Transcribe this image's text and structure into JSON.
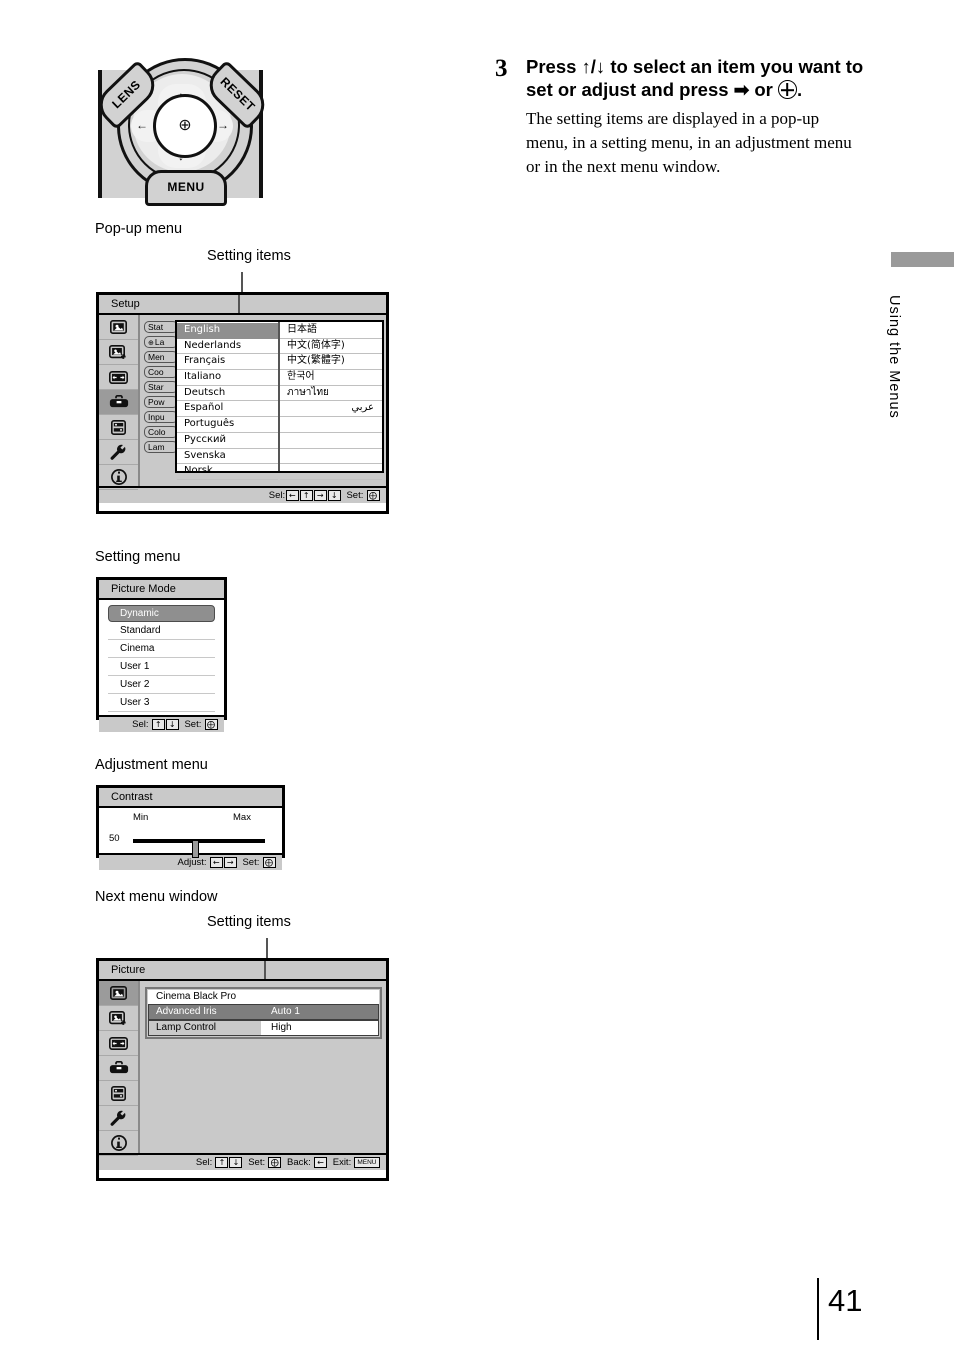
{
  "instruction": {
    "step_number": "3",
    "heading_part1": "Press",
    "heading_arrows": "↑/↓",
    "heading_part2": "to select an item you want to set or adjust and press",
    "heading_arrow_right": "➡",
    "heading_or": "or",
    "heading_period": ".",
    "description": "The setting items are displayed in a pop-up menu, in a setting menu, in an adjustment menu or in the next menu window."
  },
  "remote": {
    "lens_label": "LENS",
    "reset_label": "RESET",
    "menu_label": "MENU",
    "up_arrow": "↑",
    "down_arrow": "↓",
    "left_arrow": "←",
    "right_arrow": "→",
    "center_glyph": "⊕"
  },
  "captions": {
    "popup_menu": "Pop-up menu",
    "setting_items_1": "Setting items",
    "setting_menu": "Setting menu",
    "adjustment_menu": "Adjustment menu",
    "next_menu_window": "Next menu window",
    "setting_items_2": "Setting items"
  },
  "popup_menu": {
    "title": "Setup",
    "rail_icons": [
      "picture-icon",
      "picture-plus-icon",
      "screen-icon",
      "toolbox-icon",
      "function-list-icon",
      "wrench-icon",
      "info-icon"
    ],
    "rail_selected_index": 3,
    "hidden_items": [
      {
        "label": "Stat",
        "icon": ""
      },
      {
        "label": "La",
        "icon": "⊕"
      },
      {
        "label": "Men",
        "icon": ""
      },
      {
        "label": "Coo",
        "icon": ""
      },
      {
        "label": "Star",
        "icon": ""
      },
      {
        "label": "Pow",
        "icon": ""
      },
      {
        "label": "Inpu",
        "icon": ""
      },
      {
        "label": "Colo",
        "icon": ""
      },
      {
        "label": "Lam",
        "icon": ""
      }
    ],
    "languages_left": [
      "English",
      "Nederlands",
      "Français",
      "Italiano",
      "Deutsch",
      "Español",
      "Português",
      "Русский",
      "Svenska",
      "Norsk"
    ],
    "languages_right": [
      "日本語",
      "中文(简体字)",
      "中文(繁體字)",
      "한국어",
      "ภาษาไทย",
      "عربي"
    ],
    "selected_language": "English",
    "status": {
      "sel_label": "Sel:",
      "sel_keys": [
        "←",
        "↑",
        "→",
        "↓"
      ],
      "set_label": "Set:",
      "set_key": "⨁"
    }
  },
  "setting_menu": {
    "title": "Picture Mode",
    "items": [
      "Dynamic",
      "Standard",
      "Cinema",
      "User 1",
      "User 2",
      "User 3"
    ],
    "selected": "Dynamic",
    "status": {
      "sel_label": "Sel:",
      "sel_keys": [
        "↑",
        "↓"
      ],
      "set_label": "Set:",
      "set_key": "⨁"
    }
  },
  "adjustment_menu": {
    "title": "Contrast",
    "min_label": "Min",
    "max_label": "Max",
    "value": "50",
    "slider_percent": 47,
    "status": {
      "adjust_label": "Adjust:",
      "adjust_keys": [
        "←",
        "→"
      ],
      "set_label": "Set:",
      "set_key": "⨁"
    }
  },
  "next_menu": {
    "title": "Picture",
    "rail_icons": [
      "picture-icon",
      "picture-plus-icon",
      "screen-icon",
      "toolbox-icon",
      "function-list-icon",
      "wrench-icon",
      "info-icon"
    ],
    "rail_selected_index": 0,
    "rows": [
      {
        "label": "Cinema Black Pro",
        "value": "",
        "style": "plain"
      },
      {
        "label": "Advanced Iris",
        "value": "Auto 1",
        "style": "highlight"
      },
      {
        "label": "Lamp Control",
        "value": "High",
        "style": "normal"
      }
    ],
    "status": {
      "sel_label": "Sel:",
      "sel_keys": [
        "↑",
        "↓"
      ],
      "set_label": "Set:",
      "set_key": "⨁",
      "back_label": "Back:",
      "back_key": "←",
      "exit_label": "Exit:",
      "exit_key": "MENU"
    }
  },
  "side_tab": {
    "label": "Using the Menus",
    "color": "#9a9a9a"
  },
  "page": {
    "number": "41"
  }
}
